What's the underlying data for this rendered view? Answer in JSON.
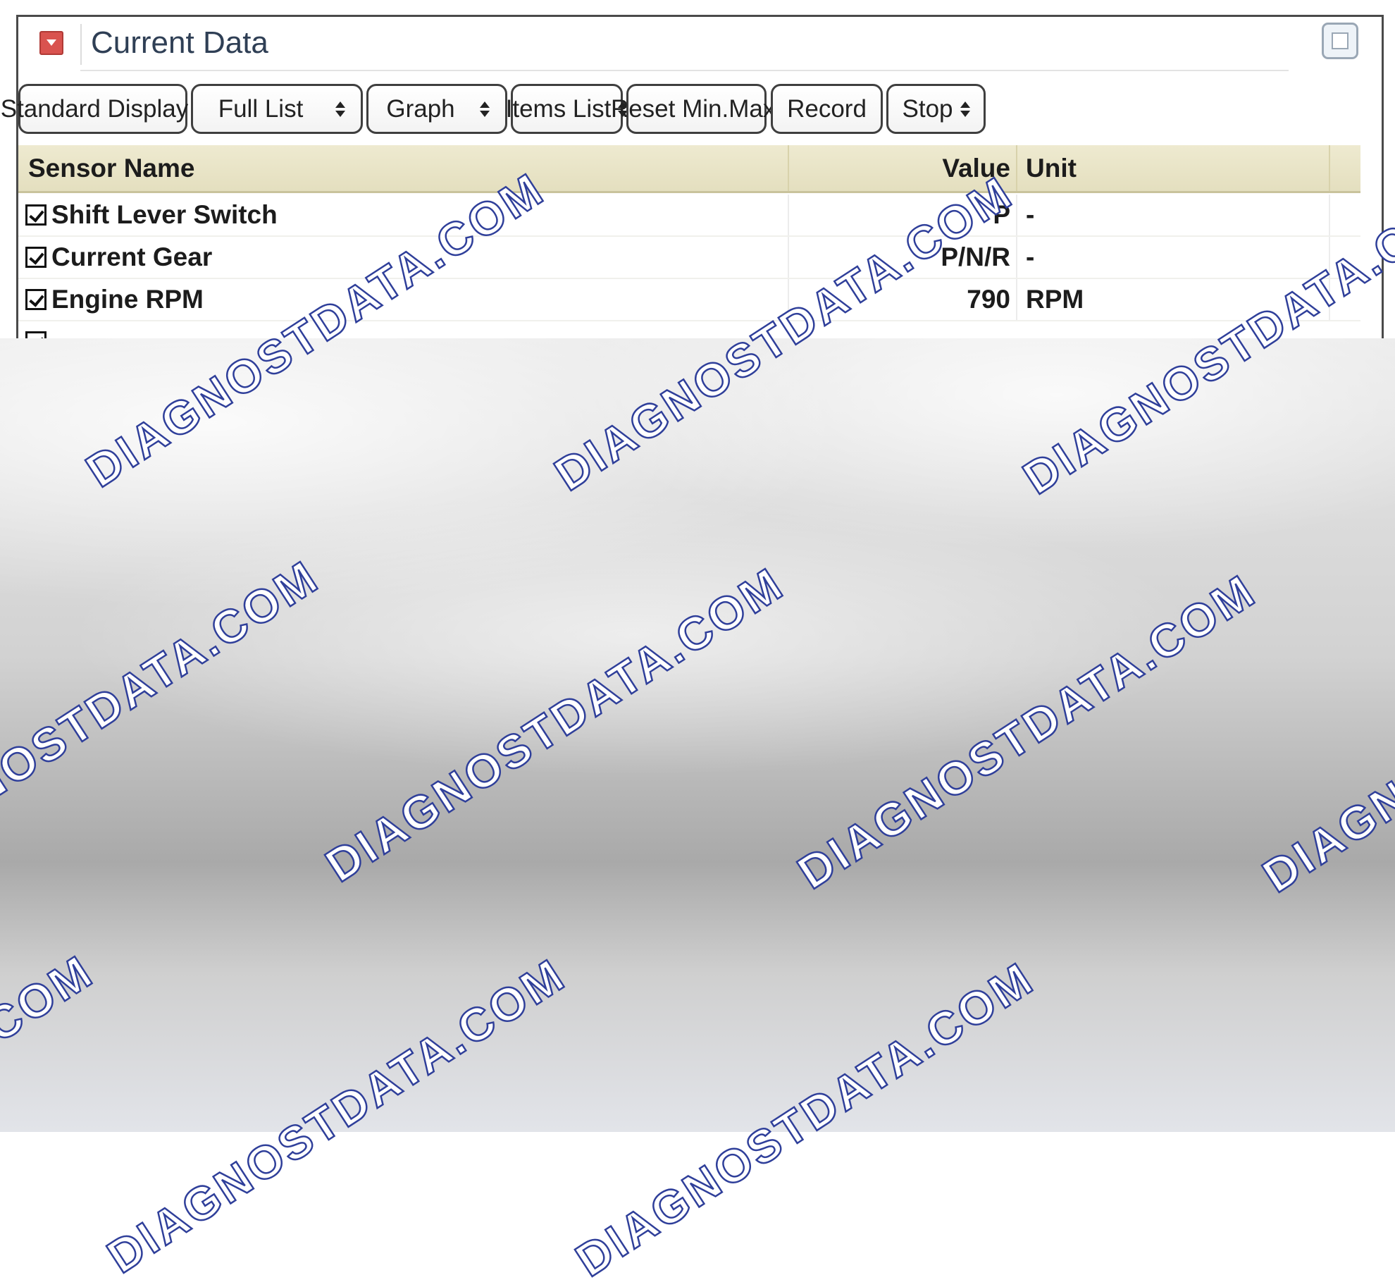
{
  "window": {
    "title": "Current Data"
  },
  "toolbar": {
    "display_mode": "Standard Display",
    "list_mode": "Full List",
    "view_mode": "Graph",
    "items_list": "Items List",
    "reset_minmax": "Reset Min.Max.",
    "record": "Record",
    "stop": "Stop"
  },
  "table": {
    "headers": {
      "name": "Sensor Name",
      "value": "Value",
      "unit": "Unit"
    },
    "rows": [
      {
        "name": "Shift Lever Switch",
        "value": "P",
        "unit": "-",
        "checked": true
      },
      {
        "name": "Current Gear",
        "value": "P/N/R",
        "unit": "-",
        "checked": true
      },
      {
        "name": "Engine RPM",
        "value": "790",
        "unit": "RPM",
        "checked": true
      }
    ]
  },
  "watermark": {
    "text_a": "DIAGNOSTDATA.COM",
    "color": "#2f3f9a"
  },
  "colors": {
    "header_bg": "#e9e5c8",
    "collapse_icon": "#d9534f",
    "title_text": "#2f3f55"
  }
}
